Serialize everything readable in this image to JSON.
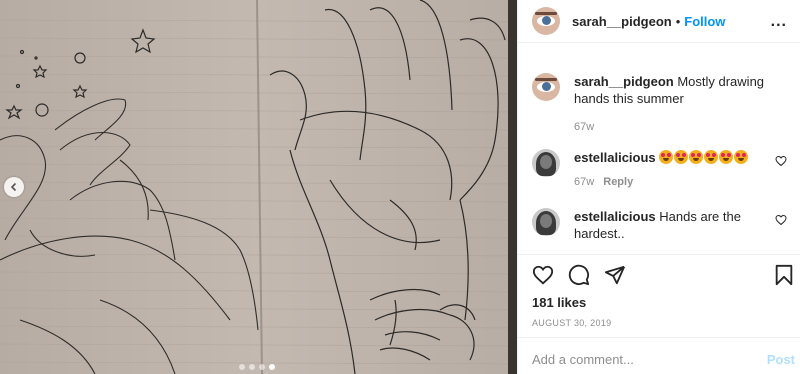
{
  "post": {
    "author": "sarah__pidgeon",
    "follow_label": "Follow",
    "separator": "•",
    "more_label": "...",
    "carousel": {
      "slides": 4,
      "active_index": 3
    }
  },
  "comments": [
    {
      "user": "sarah__pidgeon",
      "text": "Mostly drawing hands this summer",
      "time": "67w",
      "reply": ""
    },
    {
      "user": "estellalicious",
      "text": "",
      "emoji_count": 6,
      "emoji": "star-struck-emoji",
      "time": "67w",
      "reply": "Reply"
    },
    {
      "user": "estellalicious",
      "text": "Hands are the hardest..",
      "time": "",
      "reply": ""
    }
  ],
  "actions": {
    "likes": "181 likes",
    "date": "AUGUST 30, 2019",
    "comment_placeholder": "Add a comment...",
    "post_label": "Post"
  },
  "icons": [
    "chevron-left-icon",
    "heart-icon",
    "comment-icon",
    "share-icon",
    "bookmark-icon"
  ],
  "colors": {
    "link": "#0095f6",
    "muted": "#8e8e8e",
    "post_disabled": "#b2dffc"
  }
}
